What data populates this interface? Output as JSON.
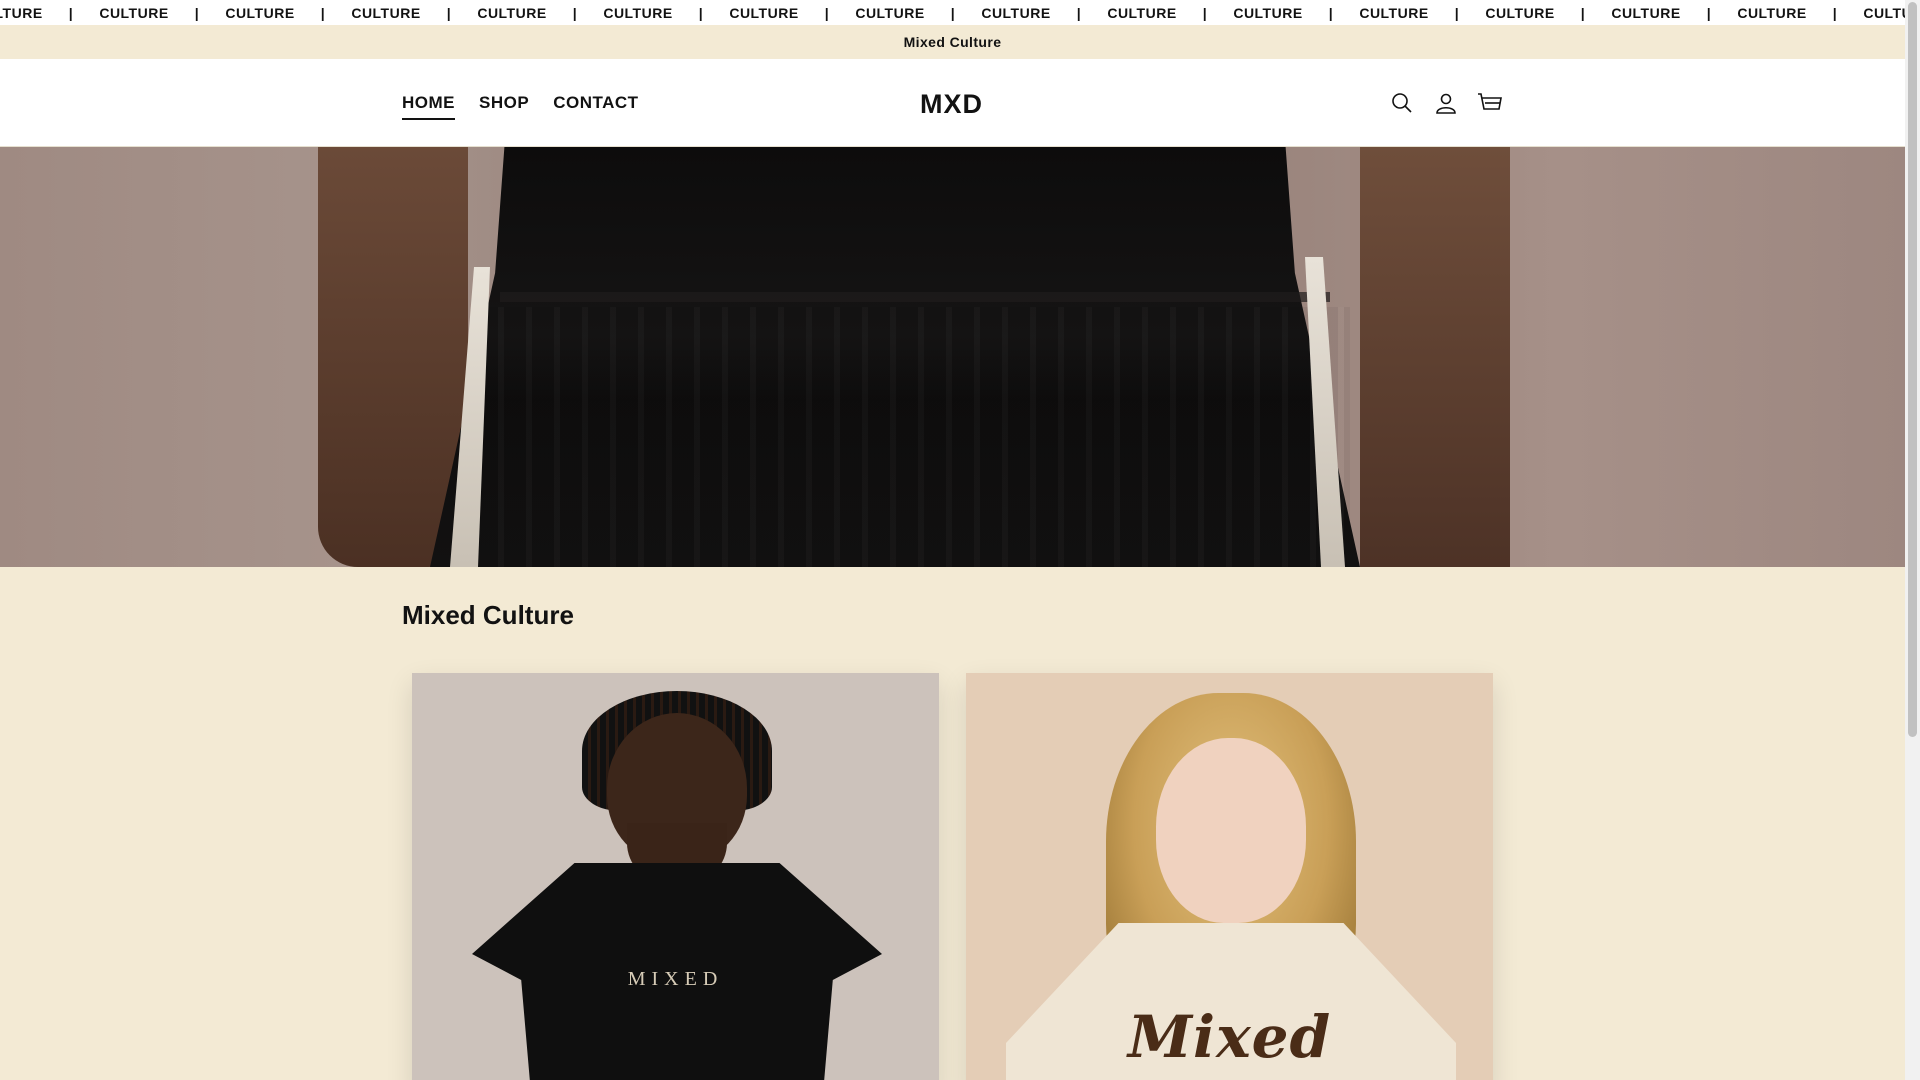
{
  "marquee": {
    "word": "CULTURE",
    "separator": "|",
    "items": [
      "CULTURE",
      "CULTURE",
      "CULTURE",
      "CULTURE",
      "CULTURE",
      "CULTURE",
      "CULTURE",
      "CULTURE",
      "CULTURE",
      "CULTURE",
      "CULTURE",
      "CULTURE",
      "CULTURE",
      "CULTURE",
      "CULTURE",
      "CULTURE"
    ]
  },
  "announcement": {
    "text": "Mixed Culture"
  },
  "header": {
    "nav": [
      {
        "label": "HOME",
        "active": true
      },
      {
        "label": "SHOP",
        "active": false
      },
      {
        "label": "CONTACT",
        "active": false
      }
    ],
    "logo": "MXD",
    "icons": [
      "search-icon",
      "account-icon",
      "cart-icon"
    ]
  },
  "section": {
    "title": "Mixed Culture",
    "cards": [
      {
        "print": "MIXED"
      },
      {
        "print": "Mixed"
      }
    ]
  },
  "colors": {
    "background": "#f3ead4",
    "header": "#ffffff",
    "text": "#121212"
  }
}
